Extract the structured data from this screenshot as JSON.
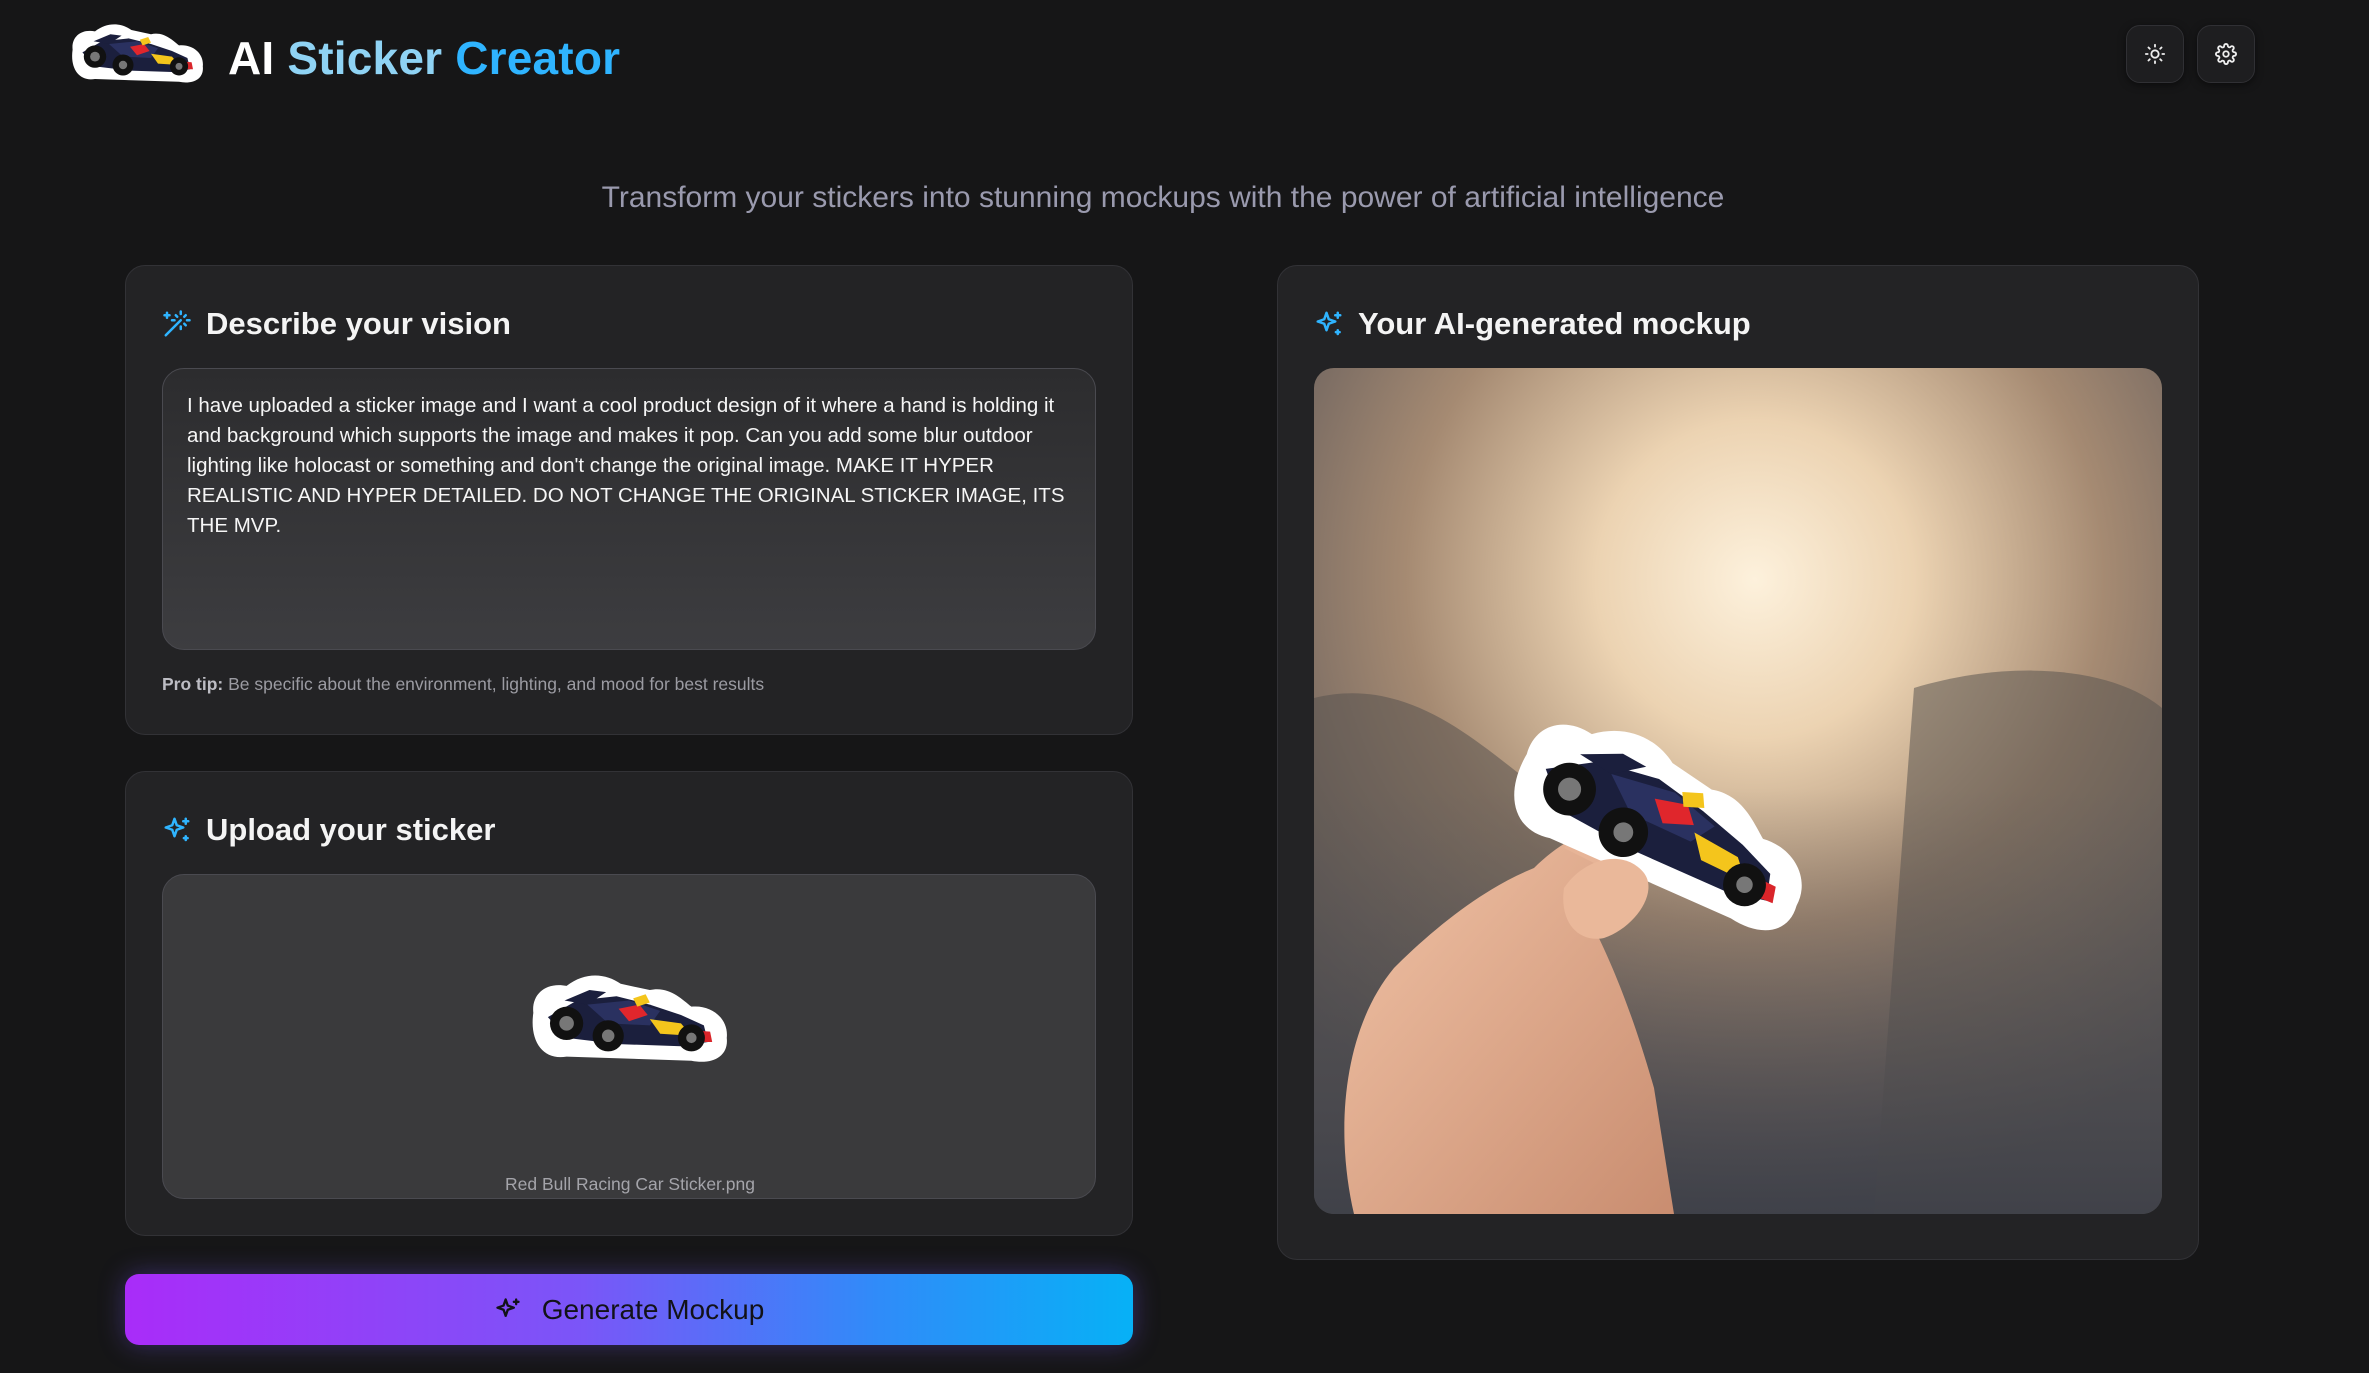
{
  "header": {
    "title_part1": "AI",
    "title_part2": "Sticker",
    "title_part3": "Creator",
    "subtitle": "Transform your stickers into stunning mockups with the power of artificial intelligence",
    "actions": [
      {
        "name": "theme-toggle",
        "icon": "sun-icon"
      },
      {
        "name": "settings",
        "icon": "gear-icon"
      }
    ]
  },
  "vision": {
    "heading": "Describe your vision",
    "icon": "magic-wand-icon",
    "prompt": "I have uploaded a sticker image and I want a cool product design of it where a hand is holding it and background which supports the image and makes it pop. Can you add some blur outdoor lighting like holocast or something and don't change the original image. MAKE IT HYPER REALISTIC AND HYPER DETAILED. DO NOT CHANGE THE ORIGINAL STICKER IMAGE, ITS THE MVP.",
    "pro_tip_label": "Pro tip:",
    "pro_tip_text": "Be specific about the environment, lighting, and mood for best results"
  },
  "upload": {
    "heading": "Upload your sticker",
    "icon": "sparkles-icon",
    "file_name": "Red Bull Racing Car Sticker.png"
  },
  "result": {
    "heading": "Your AI-generated mockup",
    "icon": "sparkles-icon"
  },
  "generate_button": {
    "label": "Generate Mockup",
    "icon": "sparkles-icon"
  },
  "colors": {
    "background": "#161617",
    "card": "#232325",
    "accent_blue": "#2fb4ff",
    "gradient_start": "#a92cf9",
    "gradient_end": "#07b1f6"
  }
}
